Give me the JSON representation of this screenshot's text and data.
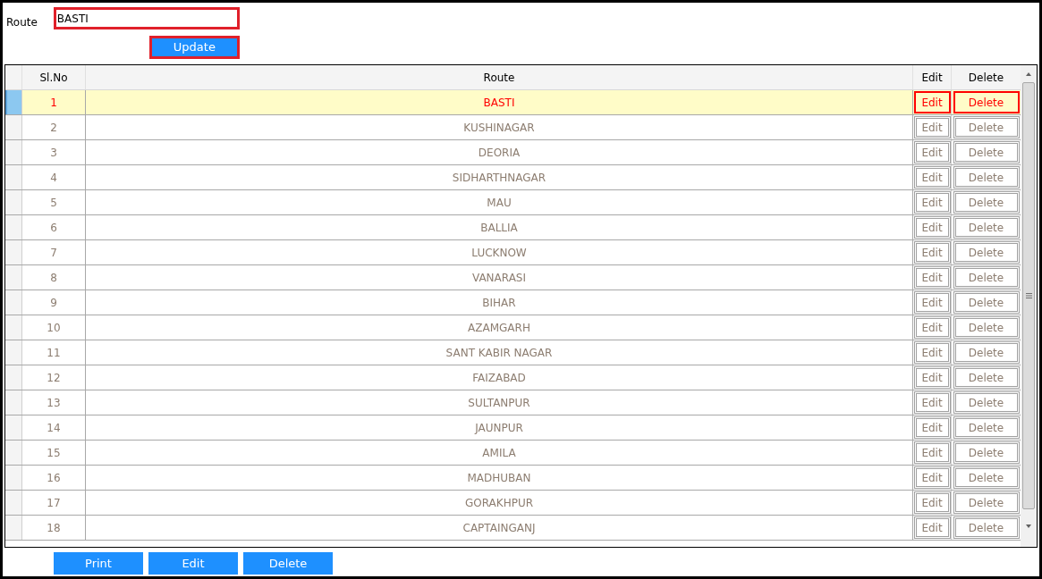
{
  "form": {
    "label": "Route",
    "value": "BASTI",
    "button": "Update"
  },
  "table": {
    "columns": [
      "Sl.No",
      "Route",
      "Edit",
      "Delete"
    ],
    "rows": [
      {
        "sl_no": "1",
        "route": "BASTI",
        "edit": "Edit",
        "delete": "Delete",
        "selected": true
      },
      {
        "sl_no": "2",
        "route": "KUSHINAGAR",
        "edit": "Edit",
        "delete": "Delete",
        "selected": false
      },
      {
        "sl_no": "3",
        "route": "DEORIA",
        "edit": "Edit",
        "delete": "Delete",
        "selected": false
      },
      {
        "sl_no": "4",
        "route": "SIDHARTHNAGAR",
        "edit": "Edit",
        "delete": "Delete",
        "selected": false
      },
      {
        "sl_no": "5",
        "route": "MAU",
        "edit": "Edit",
        "delete": "Delete",
        "selected": false
      },
      {
        "sl_no": "6",
        "route": "BALLIA",
        "edit": "Edit",
        "delete": "Delete",
        "selected": false
      },
      {
        "sl_no": "7",
        "route": "LUCKNOW",
        "edit": "Edit",
        "delete": "Delete",
        "selected": false
      },
      {
        "sl_no": "8",
        "route": "VANARASI",
        "edit": "Edit",
        "delete": "Delete",
        "selected": false
      },
      {
        "sl_no": "9",
        "route": "BIHAR",
        "edit": "Edit",
        "delete": "Delete",
        "selected": false
      },
      {
        "sl_no": "10",
        "route": "AZAMGARH",
        "edit": "Edit",
        "delete": "Delete",
        "selected": false
      },
      {
        "sl_no": "11",
        "route": "SANT KABIR NAGAR",
        "edit": "Edit",
        "delete": "Delete",
        "selected": false
      },
      {
        "sl_no": "12",
        "route": "FAIZABAD",
        "edit": "Edit",
        "delete": "Delete",
        "selected": false
      },
      {
        "sl_no": "13",
        "route": "SULTANPUR",
        "edit": "Edit",
        "delete": "Delete",
        "selected": false
      },
      {
        "sl_no": "14",
        "route": "JAUNPUR",
        "edit": "Edit",
        "delete": "Delete",
        "selected": false
      },
      {
        "sl_no": "15",
        "route": "AMILA",
        "edit": "Edit",
        "delete": "Delete",
        "selected": false
      },
      {
        "sl_no": "16",
        "route": "MADHUBAN",
        "edit": "Edit",
        "delete": "Delete",
        "selected": false
      },
      {
        "sl_no": "17",
        "route": "GORAKHPUR",
        "edit": "Edit",
        "delete": "Delete",
        "selected": false
      },
      {
        "sl_no": "18",
        "route": "CAPTAINGANJ",
        "edit": "Edit",
        "delete": "Delete",
        "selected": false
      }
    ]
  },
  "buttons": [
    "Print",
    "Edit",
    "Delete"
  ]
}
